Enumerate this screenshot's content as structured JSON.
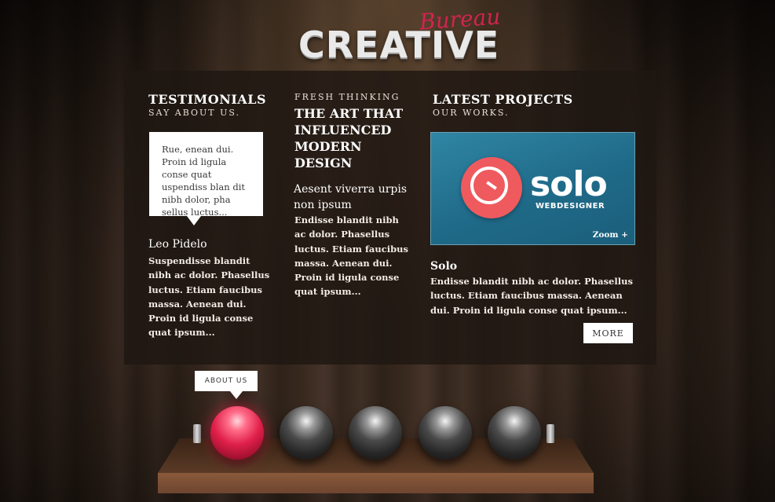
{
  "logo": {
    "main": "CREATIVE",
    "script": "Bureau"
  },
  "testimonials": {
    "title": "TESTIMONIALS",
    "subtitle": "SAY ABOUT US.",
    "quote": "Rue, enean dui. Proin id ligula conse quat uspendiss blan dit nibh dolor, pha sellus luctus...",
    "name": "Leo Pidelo",
    "text": "Suspendisse blandit nibh ac dolor. Phasellus luctus. Etiam faucibus massa. Aenean dui. Proin id ligula conse quat ipsum..."
  },
  "fresh": {
    "kicker": "FRESH THINKING",
    "title": "THE ART THAT INFLUENCED MODERN DESIGN",
    "lead": "Aesent viverra urpis non ipsum",
    "text": "Endisse blandit nibh ac dolor. Phasellus luctus. Etiam faucibus massa. Aenean dui. Proin id ligula conse quat ipsum..."
  },
  "latest": {
    "title": "LATEST PROJECTS",
    "subtitle": "OUR WORKS.",
    "image_word": "solo",
    "image_sub": "WEBDESIGNER",
    "zoom": "Zoom +",
    "project_name": "Solo",
    "project_text": "Endisse blandit nibh ac dolor. Phasellus luctus. Etiam faucibus massa. Aenean dui. Proin id ligula conse quat ipsum...",
    "more": "MORE"
  },
  "nav": {
    "tooltip": "ABOUT US",
    "active_index": 0,
    "items": 5
  },
  "colors": {
    "accent": "#e0204a",
    "panel": "#1e1612",
    "project_bg": "#1f6a88",
    "solo_circle": "#ef5a5e"
  }
}
